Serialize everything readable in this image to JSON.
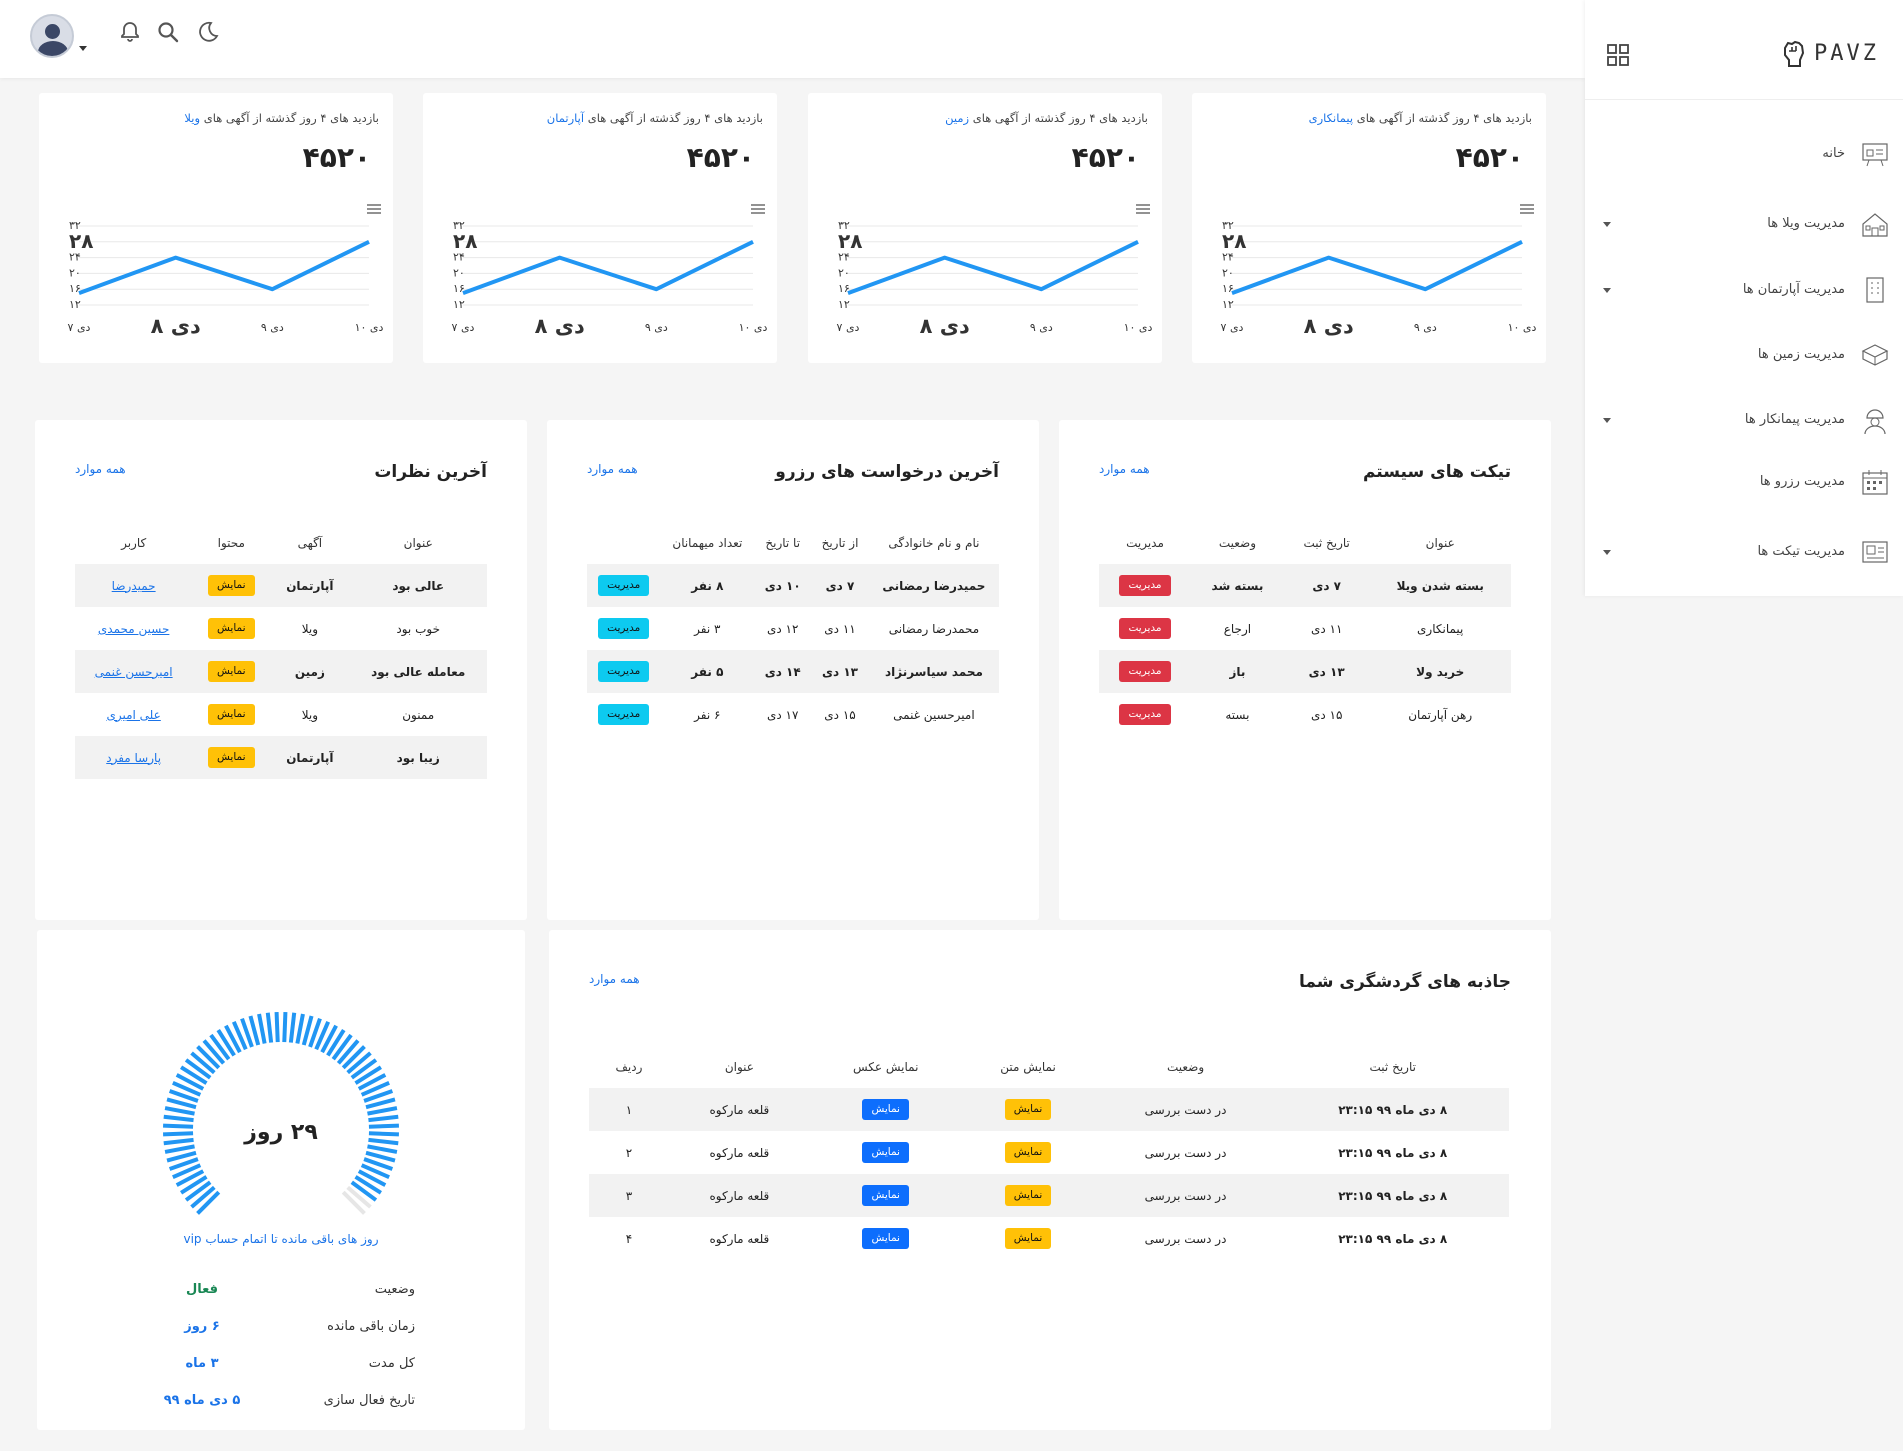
{
  "topbar": {
    "icons": [
      "moon-icon",
      "search-icon",
      "bell-icon"
    ],
    "avatar": "user-avatar"
  },
  "sidebar": {
    "brand": "PAVZ",
    "items": [
      {
        "label": "خانه",
        "icon": "dashboard-icon",
        "has_children": false
      },
      {
        "label": "مدیریت ویلا ها",
        "icon": "villa-icon",
        "has_children": true
      },
      {
        "label": "مدیریت آپارتمان ها",
        "icon": "apartment-icon",
        "has_children": true
      },
      {
        "label": "مدیریت زمین ها",
        "icon": "land-icon",
        "has_children": false
      },
      {
        "label": "مدیریت پیمانکار ها",
        "icon": "contractor-icon",
        "has_children": true
      },
      {
        "label": "مدیریت رزرو ها",
        "icon": "calendar-icon",
        "has_children": false
      },
      {
        "label": "مدیریت تیکت ها",
        "icon": "ticket-icon",
        "has_children": true
      }
    ]
  },
  "stats": [
    {
      "prefix": "بازدید های ۴ روز گذشته از آگهی های ",
      "highlight": "پیمانکاری",
      "value": "۴۵۲۰"
    },
    {
      "prefix": "بازدید های ۴ روز گذشته از آگهی های ",
      "highlight": "زمین",
      "value": "۴۵۲۰"
    },
    {
      "prefix": "بازدید های ۴ روز گذشته از آگهی های ",
      "highlight": "آپارتمان",
      "value": "۴۵۲۰"
    },
    {
      "prefix": "بازدید های ۴ روز گذشته از آگهی های ",
      "highlight": "ویلا",
      "value": "۴۵۲۰"
    }
  ],
  "chart_data": {
    "type": "line",
    "categories": [
      "۷ دی",
      "۸ دی",
      "۹ دی",
      "۱۰ دی"
    ],
    "values": [
      15,
      24,
      16,
      28
    ],
    "ylim": [
      12,
      32
    ],
    "yticks": [
      "۱۲",
      "۱۶",
      "۲۰",
      "۲۴",
      "۲۸",
      "۳۲"
    ],
    "color": "#2196f3"
  },
  "tickets": {
    "title": "تیکت های سیستم",
    "link": "همه موارد",
    "headers": [
      "عنوان",
      "تاریخ ثبت",
      "وضعیت",
      "مدیریت"
    ],
    "rows": [
      {
        "title": "بسته شدن ویلا",
        "date": "۷ دی",
        "status": "بسته شد",
        "action": "مدیریت",
        "bold": true
      },
      {
        "title": "پیمانکاری",
        "date": "۱۱ دی",
        "status": "ارجاع",
        "action": "مدیریت",
        "bold": false
      },
      {
        "title": "خرید ولا",
        "date": "۱۳ دی",
        "status": "باز",
        "action": "مدیریت",
        "bold": true
      },
      {
        "title": "رهن آپارتمان",
        "date": "۱۵ دی",
        "status": "بسته",
        "action": "مدیریت",
        "bold": false
      }
    ]
  },
  "reservations": {
    "title": "آخرین درخواست های رزرو",
    "link": "همه موارد",
    "headers": [
      "نام و نام خانوادگی",
      "از تاریخ",
      "تا تاریخ",
      "تعداد میهمانان",
      ""
    ],
    "rows": [
      {
        "name": "حمیدرضا رمضانی",
        "from": "۷ دی",
        "to": "۱۰ دی",
        "guests": "۸ نفر",
        "action": "مدیریت",
        "bold": true
      },
      {
        "name": "محمدرضا رمضانی",
        "from": "۱۱ دی",
        "to": "۱۲ دی",
        "guests": "۳ نفر",
        "action": "مدیریت",
        "bold": false
      },
      {
        "name": "محمد سیاسرنژاد",
        "from": "۱۳ دی",
        "to": "۱۴ دی",
        "guests": "۵ نفر",
        "action": "مدیریت",
        "bold": true
      },
      {
        "name": "امیرحسین غنمی",
        "from": "۱۵ دی",
        "to": "۱۷ دی",
        "guests": "۶ نفر",
        "action": "مدیریت",
        "bold": false
      }
    ]
  },
  "comments": {
    "title": "آخرین نظرات",
    "link": "همه موارد",
    "headers": [
      "عنوان",
      "آگهی",
      "محتوا",
      "کاربر"
    ],
    "rows": [
      {
        "title": "عالی بود",
        "ad": "آپارتمان",
        "content": "نمایش",
        "user": "حمیدرضا",
        "bold": true
      },
      {
        "title": "خوب بود",
        "ad": "ویلا",
        "content": "نمایش",
        "user": "حسین محمدی",
        "bold": false
      },
      {
        "title": "معامله عالی بود",
        "ad": "زمین",
        "content": "نمایش",
        "user": "امیرحسن غنمی",
        "bold": true
      },
      {
        "title": "ممنون",
        "ad": "ویلا",
        "content": "نمایش",
        "user": "علی امیری",
        "bold": false
      },
      {
        "title": "زیبا بود",
        "ad": "آپارتمان",
        "content": "نمایش",
        "user": "پارسا مفرد",
        "bold": true
      }
    ]
  },
  "attractions": {
    "title": "جاذبه های گردشگری شما",
    "link": "همه موارد",
    "headers": [
      "تاریخ ثبت",
      "وضعیت",
      "نمایش متن",
      "نمایش عکس",
      "عنوان",
      "ردیف"
    ],
    "rows": [
      {
        "date": "۸ دی ماه ۹۹ ۲۳:۱۵",
        "status": "در دست بررسی",
        "text": "نمایش",
        "image": "نمایش",
        "title": "قلعه مارکوه",
        "row": "۱"
      },
      {
        "date": "۸ دی ماه ۹۹ ۲۳:۱۵",
        "status": "در دست بررسی",
        "text": "نمایش",
        "image": "نمایش",
        "title": "قلعه مارکوه",
        "row": "۲"
      },
      {
        "date": "۸ دی ماه ۹۹ ۲۳:۱۵",
        "status": "در دست بررسی",
        "text": "نمایش",
        "image": "نمایش",
        "title": "قلعه مارکوه",
        "row": "۳"
      },
      {
        "date": "۸ دی ماه ۹۹ ۲۳:۱۵",
        "status": "در دست بررسی",
        "text": "نمایش",
        "image": "نمایش",
        "title": "قلعه مارکوه",
        "row": "۴"
      }
    ]
  },
  "vip": {
    "gauge_value": "۲۹ روز",
    "gauge_fraction": 0.97,
    "caption": "روز های باقی مانده تا اتمام حساب vip",
    "rows": [
      {
        "label": "وضعیت",
        "value": "فعال",
        "color": "#198754"
      },
      {
        "label": "زمان باقی مانده",
        "value": "۶ روز",
        "color": "#1a73e8"
      },
      {
        "label": "کل مدت",
        "value": "۳ ماه",
        "color": "#1a73e8"
      },
      {
        "label": "تاریخ فعال سازی",
        "value": "۵ دی ماه ۹۹",
        "color": "#1a73e8"
      }
    ]
  }
}
